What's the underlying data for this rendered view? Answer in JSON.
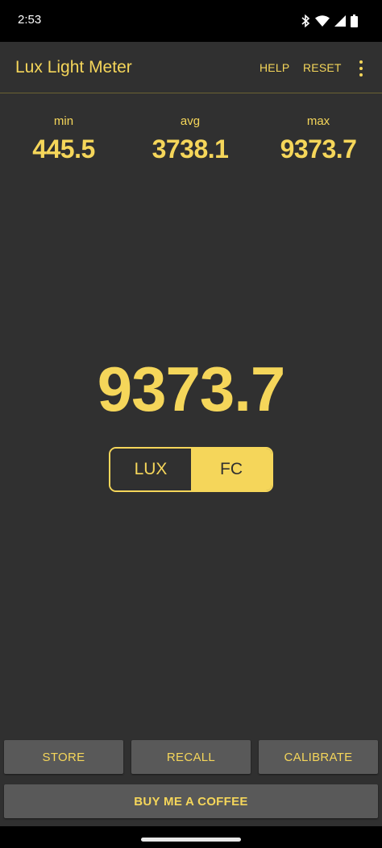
{
  "status_bar": {
    "time": "2:53",
    "icons": [
      "bluetooth-icon",
      "wifi-icon",
      "signal-icon",
      "battery-icon"
    ]
  },
  "app_bar": {
    "title": "Lux Light Meter",
    "help_label": "HELP",
    "reset_label": "RESET",
    "overflow_icon": "more-vert-icon"
  },
  "stats": {
    "min": {
      "label": "min",
      "value": "445.5"
    },
    "avg": {
      "label": "avg",
      "value": "3738.1"
    },
    "max": {
      "label": "max",
      "value": "9373.7"
    }
  },
  "reading": "9373.7",
  "units": {
    "options": [
      "LUX",
      "FC"
    ],
    "selected": "FC"
  },
  "buttons": {
    "store": "STORE",
    "recall": "RECALL",
    "calibrate": "CALIBRATE",
    "coffee": "BUY ME A COFFEE"
  },
  "colors": {
    "accent": "#f5d65a",
    "background": "#303030",
    "button": "#595959"
  }
}
